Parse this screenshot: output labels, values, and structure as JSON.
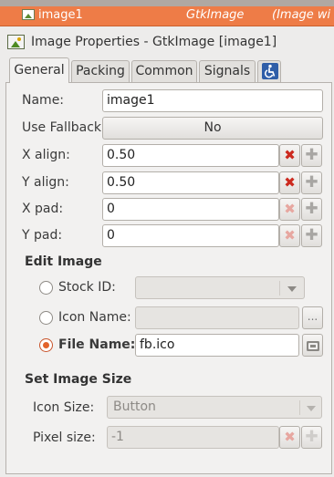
{
  "tree_row": {
    "name": "image1",
    "class": "GtkImage",
    "extra": "(Image wi"
  },
  "editor": {
    "title": "Image Properties - GtkImage [image1]"
  },
  "tabs": [
    {
      "label": "General",
      "active": true
    },
    {
      "label": "Packing",
      "active": false
    },
    {
      "label": "Common",
      "active": false
    },
    {
      "label": "Signals",
      "active": false
    },
    {
      "icon": "accessibility-icon",
      "active": false
    }
  ],
  "general": {
    "name_label": "Name:",
    "name_value": "image1",
    "fallback_label": "Use Fallback:",
    "fallback_value": "No",
    "xalign_label": "X align:",
    "xalign_value": "0.50",
    "yalign_label": "Y align:",
    "yalign_value": "0.50",
    "xpad_label": "X pad:",
    "xpad_value": "0",
    "ypad_label": "Y pad:",
    "ypad_value": "0"
  },
  "edit_image": {
    "heading": "Edit Image",
    "stock_label": "Stock ID:",
    "stock_value": "",
    "iconname_label": "Icon Name:",
    "iconname_value": "",
    "ellipsis": "...",
    "filename_label": "File Name:",
    "filename_value": "fb.ico",
    "selected": "file_name"
  },
  "image_size": {
    "heading": "Set Image Size",
    "iconsize_label": "Icon Size:",
    "iconsize_value": "Button",
    "pixelsize_label": "Pixel size:",
    "pixelsize_value": "-1"
  },
  "colors": {
    "selection": "#ee7c47",
    "reset_red": "#cc2a1f",
    "radio_active": "#e2632b"
  }
}
